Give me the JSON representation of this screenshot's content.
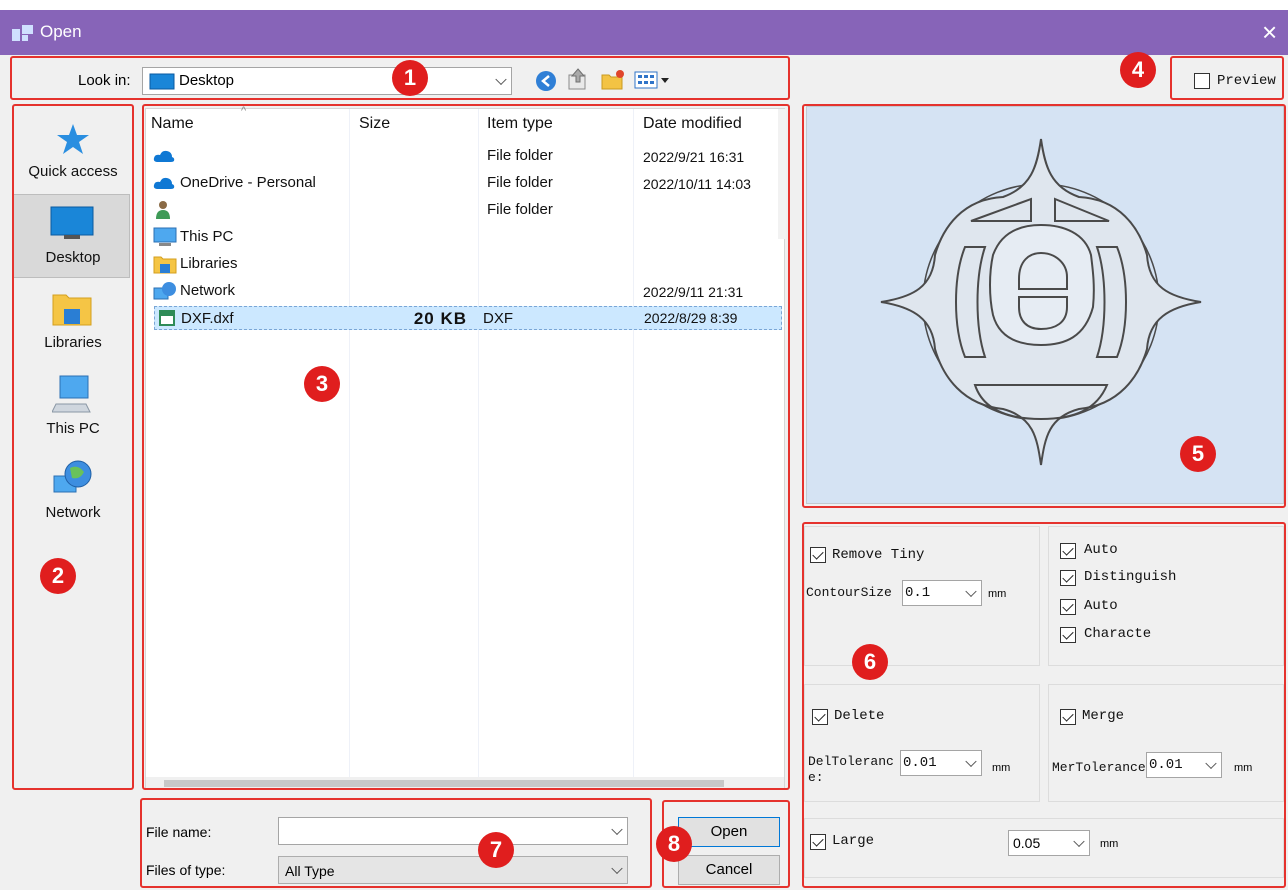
{
  "window": {
    "title": "Open",
    "close_glyph": "×"
  },
  "toolbar": {
    "look_in_label": "Look in:",
    "location": "Desktop"
  },
  "places": [
    {
      "label": "Quick access",
      "icon": "star-icon"
    },
    {
      "label": "Desktop",
      "icon": "desktop-icon",
      "selected": true
    },
    {
      "label": "Libraries",
      "icon": "libraries-icon"
    },
    {
      "label": "This PC",
      "icon": "computer-icon"
    },
    {
      "label": "Network",
      "icon": "network-icon"
    }
  ],
  "file_list": {
    "columns": [
      "Name",
      "Size",
      "Item type",
      "Date modified"
    ],
    "rows": [
      {
        "name": "",
        "icon": "cloud-icon",
        "size": "",
        "type": "File folder",
        "date": "2022/9/21 16:31"
      },
      {
        "name": "OneDrive - Personal",
        "icon": "cloud-icon",
        "size": "",
        "type": "File folder",
        "date": "2022/10/11 14:03"
      },
      {
        "name": "",
        "icon": "user-icon",
        "size": "",
        "type": "File folder",
        "date": ""
      },
      {
        "name": "This PC",
        "icon": "computer-icon",
        "size": "",
        "type": "",
        "date": ""
      },
      {
        "name": "Libraries",
        "icon": "libraries-icon",
        "size": "",
        "type": "",
        "date": ""
      },
      {
        "name": "Network",
        "icon": "network-icon",
        "size": "",
        "type": "",
        "date": "2022/9/11 21:31"
      },
      {
        "name": "DXF.dxf",
        "icon": "dxf-file-icon",
        "size": "20 KB",
        "type": "DXF",
        "date": "2022/8/29 8:39",
        "selected": true
      }
    ]
  },
  "preview": {
    "label": "Preview",
    "checked": false
  },
  "options": {
    "remove_tiny": {
      "label": "Remove Tiny",
      "checked": true
    },
    "contour_size": {
      "label": "ContourSize",
      "value": "0.1",
      "unit": "mm"
    },
    "auto1": {
      "label": "Auto",
      "checked": true
    },
    "distinguish": {
      "label": "Distinguish",
      "checked": true
    },
    "auto2": {
      "label": "Auto",
      "checked": true
    },
    "characte": {
      "label": "Characte",
      "checked": true
    },
    "delete": {
      "label": "Delete",
      "checked": true
    },
    "del_tolerance": {
      "label": "DelTolerance:",
      "value": "0.01",
      "unit": "mm"
    },
    "merge": {
      "label": "Merge",
      "checked": true
    },
    "mer_tolerance": {
      "label": "MerTolerance",
      "value": "0.01",
      "unit": "mm"
    },
    "large": {
      "label": "Large",
      "checked": true,
      "value": "0.05",
      "unit": "mm"
    }
  },
  "bottom": {
    "file_name_label": "File name:",
    "file_name_value": "",
    "file_type_label": "Files of type:",
    "file_type_value": "All Type",
    "open_label": "Open",
    "cancel_label": "Cancel"
  },
  "badges": [
    "1",
    "2",
    "3",
    "4",
    "5",
    "6",
    "7",
    "8"
  ],
  "colors": {
    "titlebar": "#8764b8",
    "highlight": "#e01e1e",
    "selection": "#cce8ff",
    "preview_bg": "#d5e3f3"
  }
}
